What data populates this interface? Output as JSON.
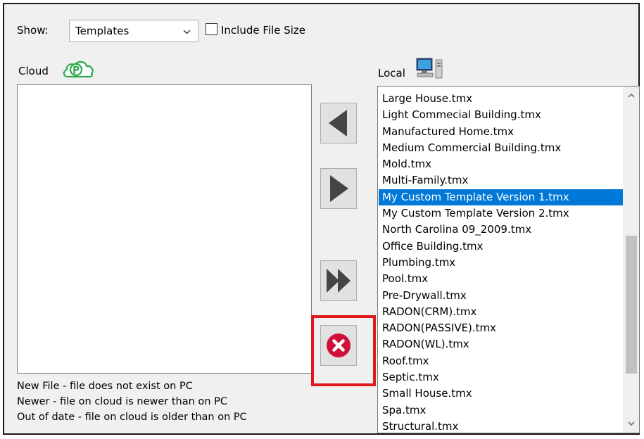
{
  "show": {
    "label": "Show:",
    "selected": "Templates",
    "include_file_size_label": "Include File Size",
    "include_file_size_checked": false
  },
  "cloud": {
    "label": "Cloud",
    "icon": "cloud-icon",
    "items": []
  },
  "local": {
    "label": "Local",
    "icon": "computer-icon",
    "items": [
      "Large House.tmx",
      "Light Commecial Building.tmx",
      "Manufactured Home.tmx",
      "Medium Commercial Building.tmx",
      "Mold.tmx",
      "Multi-Family.tmx",
      "My Custom Template Version 1.tmx",
      "My Custom Template Version 2.tmx",
      "North Carolina 09_2009.tmx",
      "Office Building.tmx",
      "Plumbing.tmx",
      "Pool.tmx",
      "Pre-Drywall.tmx",
      "RADON(CRM).tmx",
      "RADON(PASSIVE).tmx",
      "RADON(WL).tmx",
      "Roof.tmx",
      "Septic.tmx",
      "Small House.tmx",
      "Spa.tmx",
      "Structural.tmx"
    ],
    "selected_index": 6
  },
  "actions": {
    "upload_icon": "arrow-left-icon",
    "download_icon": "arrow-right-icon",
    "sync_all_icon": "double-arrow-right-icon",
    "delete_icon": "delete-x-icon",
    "delete_color": "#d0103a",
    "highlight_color": "#e01a1a"
  },
  "legend": [
    "New File - file does not exist on PC",
    "Newer - file on cloud is newer than on PC",
    "Out of date - file on cloud is older than on PC"
  ],
  "colors": {
    "selection": "#0078d7",
    "cloud_icon": "#2aa84a"
  }
}
